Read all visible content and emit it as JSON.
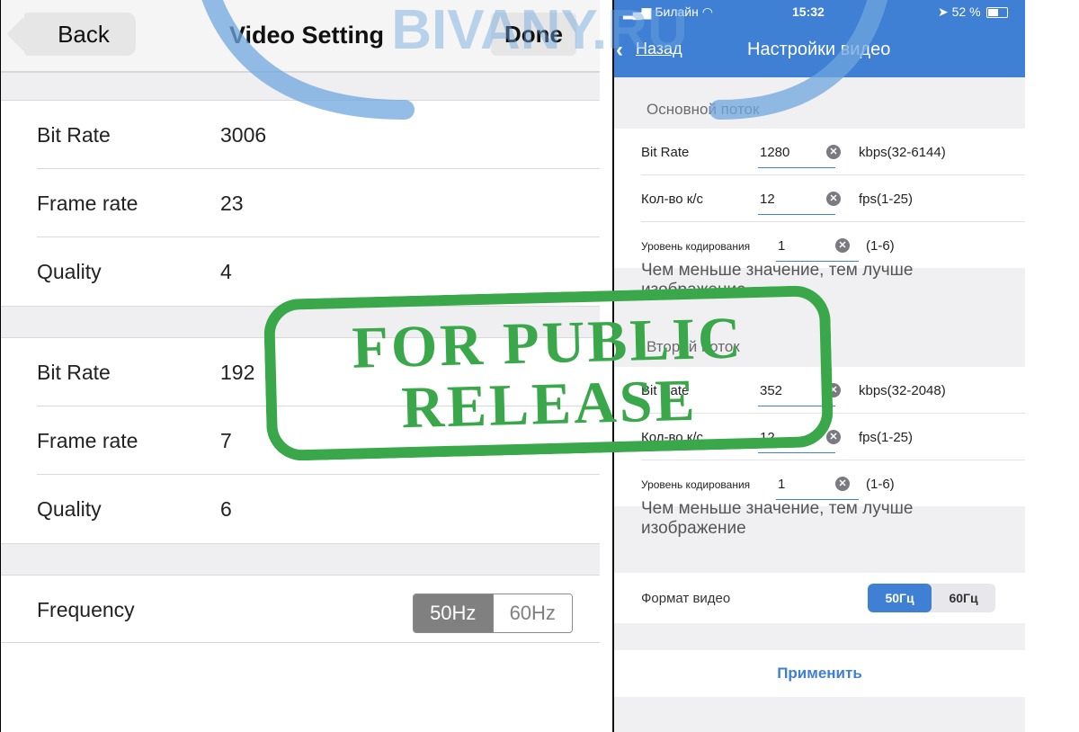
{
  "left": {
    "back_label": "Back",
    "title": "Video Setting",
    "done_label": "Done",
    "stream1": {
      "rows": [
        {
          "label": "Bit Rate",
          "value": "3006"
        },
        {
          "label": "Frame rate",
          "value": "23"
        },
        {
          "label": "Quality",
          "value": "4"
        }
      ]
    },
    "stream2": {
      "rows": [
        {
          "label": "Bit Rate",
          "value": "192"
        },
        {
          "label": "Frame rate",
          "value": "7"
        },
        {
          "label": "Quality",
          "value": "6"
        }
      ]
    },
    "frequency": {
      "label": "Frequency",
      "options": [
        "50Hz",
        "60Hz"
      ],
      "selected": "50Hz"
    }
  },
  "right": {
    "status": {
      "carrier": "Билайн",
      "time": "15:32",
      "battery": "52 %"
    },
    "back_label": "Назад",
    "title": "Настройки видео",
    "main_stream": {
      "header": "Основной поток",
      "bitrate": {
        "label": "Bit Rate",
        "value": "1280",
        "range": "kbps(32-6144)"
      },
      "fps": {
        "label": "Кол-во к/с",
        "value": "12",
        "range": "fps(1-25)"
      },
      "encoding": {
        "label": "Уровень кодирования",
        "value": "1",
        "range": "(1-6)"
      },
      "hint": "Чем меньше значение, тем лучше изображение"
    },
    "second_stream": {
      "header": "Второй поток",
      "bitrate": {
        "label": "Bit Rate",
        "value": "352",
        "range": "kbps(32-2048)"
      },
      "fps": {
        "label": "Кол-во к/с",
        "value": "12",
        "range": "fps(1-25)"
      },
      "encoding": {
        "label": "Уровень кодирования",
        "value": "1",
        "range": "(1-6)"
      },
      "hint": "Чем меньше значение, тем лучше изображение"
    },
    "format": {
      "label": "Формат видео",
      "options": [
        "50Гц",
        "60Гц"
      ],
      "selected": "50Гц"
    },
    "apply_label": "Применить"
  },
  "watermark": {
    "text": "BIVANY.RU"
  },
  "stamp": {
    "line1": "FOR PUBLIC",
    "line2": "RELEASE"
  },
  "colors": {
    "ios_blue": "#3f7fd4",
    "stamp_green": "#3aa84a",
    "watermark_blue": "#6fa6de"
  }
}
